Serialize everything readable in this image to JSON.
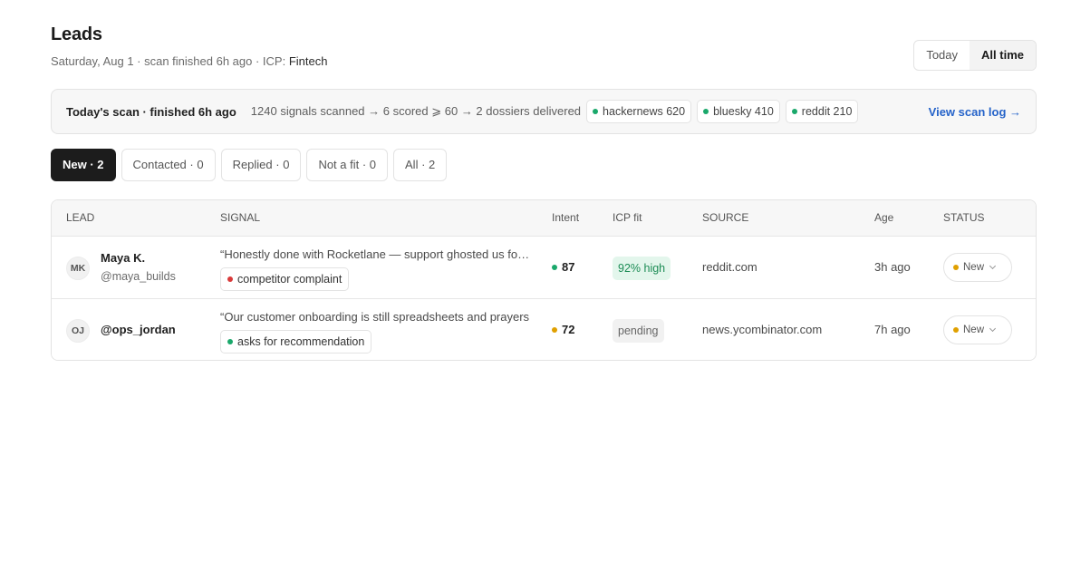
{
  "header": {
    "title": "Leads",
    "subtitle_prefix": "Saturday, Aug 1 · scan finished 6h ago · ICP: ",
    "icp_value": "Fintech",
    "range_options": [
      {
        "label": "Today",
        "active": false
      },
      {
        "label": "All time",
        "active": true
      }
    ]
  },
  "scan": {
    "title": "Today's scan · finished 6h ago",
    "stats": "1240 signals scanned → 6 scored ⩾ 60 → 2 dossiers delivered",
    "sources": [
      {
        "label": "hackernews 620",
        "color": "#1aa86b"
      },
      {
        "label": "bluesky 410",
        "color": "#1aa86b"
      },
      {
        "label": "reddit 210",
        "color": "#1aa86b"
      }
    ],
    "link_label": "View scan log →"
  },
  "tabs": [
    {
      "label": "New · 2",
      "active": true
    },
    {
      "label": "Contacted · 0",
      "active": false
    },
    {
      "label": "Replied · 0",
      "active": false
    },
    {
      "label": "Not a fit · 0",
      "active": false
    },
    {
      "label": "All · 2",
      "active": false
    }
  ],
  "table": {
    "columns": {
      "lead": "LEAD",
      "signal": "SIGNAL",
      "intent": "Intent",
      "icp": "ICP fit",
      "source": "SOURCE",
      "age": "Age",
      "status": "STATUS"
    },
    "rows": [
      {
        "initials": "MK",
        "name": "Maya K.",
        "handle": "@maya_builds",
        "quote": "“Honestly done with Rocketlane — support ghosted us for a week",
        "tag": "competitor complaint",
        "tag_color": "#d93a3a",
        "intent": "87",
        "intent_color": "#1aa86b",
        "icp": "92% high",
        "icp_state": "high",
        "source": "reddit.com",
        "age": "3h ago",
        "status": "New",
        "status_color": "#e0a000"
      },
      {
        "initials": "OJ",
        "name": "@ops_jordan",
        "handle": "",
        "quote": "“Our customer onboarding is still spreadsheets and prayers",
        "tag": "asks for recommendation",
        "tag_color": "#1aa86b",
        "intent": "72",
        "intent_color": "#e0a000",
        "icp": "pending",
        "icp_state": "pending",
        "source": "news.ycombinator.com",
        "age": "7h ago",
        "status": "New",
        "status_color": "#e0a000"
      }
    ]
  }
}
